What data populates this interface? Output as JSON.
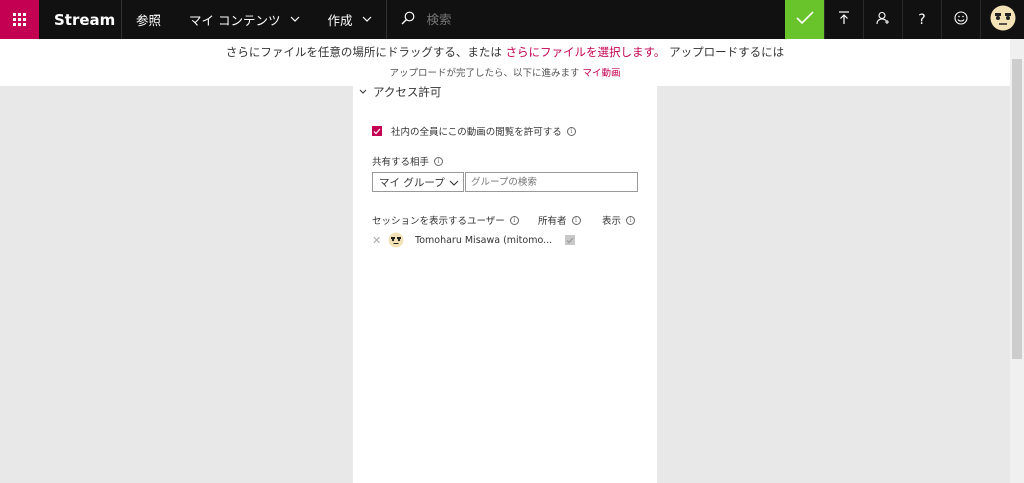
{
  "topbar": {
    "brand": "Stream",
    "nav": {
      "browse": "参照",
      "my_content": "マイ コンテンツ",
      "create": "作成"
    },
    "search": {
      "placeholder": "検索"
    },
    "icons": [
      "check-icon",
      "upload-icon",
      "invite-icon",
      "help-icon",
      "feedback-smiley-icon",
      "user-avatar"
    ],
    "colors": {
      "waffle": "#c30052",
      "check": "#69c32a",
      "bar": "#111111"
    }
  },
  "notice": {
    "line1_pre": "さらにファイルを任意の場所にドラッグする、または ",
    "line1_link": "さらにファイルを選択します。",
    "line1_post": " アップロードするには",
    "line2_pre": "アップロードが完了したら、以下に進みます ",
    "line2_link": "マイ動画"
  },
  "panel": {
    "section_title": "アクセス許可",
    "allow_all_label": "社内の全員にこの動画の閲覧を許可する",
    "allow_all_checked": true,
    "share_with_label": "共有する相手",
    "share_select_value": "マイ グループ",
    "group_search_placeholder": "グループの検索",
    "columns": {
      "users": "セッションを表示するユーザー",
      "owner": "所有者",
      "show": "表示"
    },
    "users": [
      {
        "name": "Tomoharu Misawa (mitomo...",
        "owner": true
      }
    ]
  }
}
